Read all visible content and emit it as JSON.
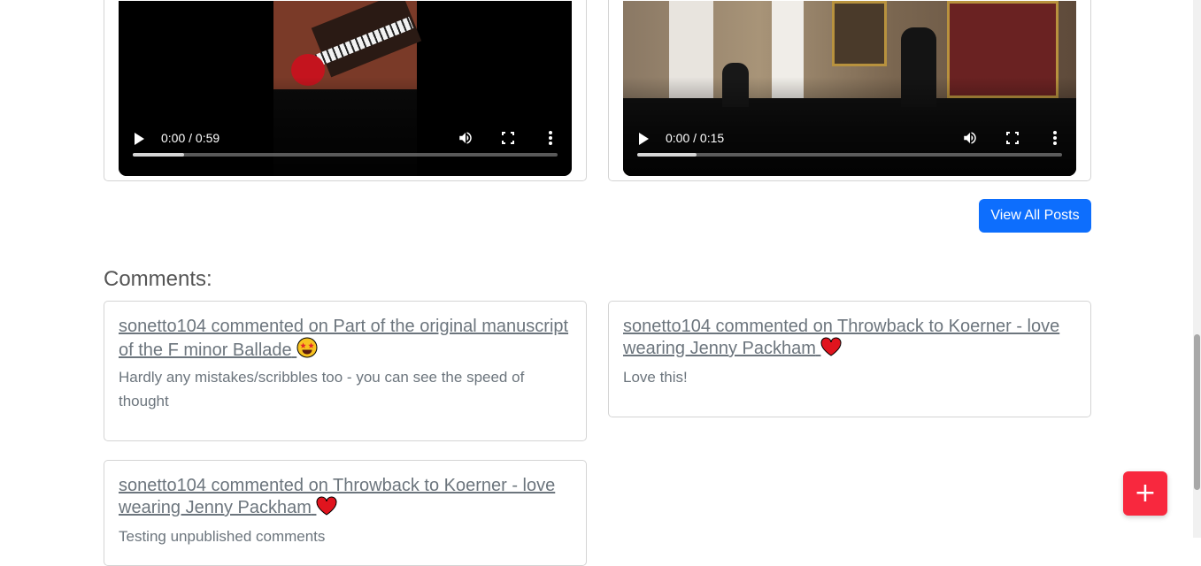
{
  "videos": [
    {
      "time": "0:00 / 0:59",
      "buffered_fraction": 0.12
    },
    {
      "time": "0:00 / 0:15",
      "buffered_fraction": 0.14
    }
  ],
  "view_all_label": "View All Posts",
  "comments_heading": "Comments:",
  "comments": [
    {
      "title": "sonetto104 commented on Part of the original manuscript of the F minor Ballade",
      "emoji": "star-struck",
      "body": "Hardly any mistakes/scribbles too - you can see the speed of thought"
    },
    {
      "title": "sonetto104 commented on Throwback to Koerner - love wearing Jenny Packham",
      "emoji": "heart",
      "body": "Love this!"
    },
    {
      "title": "sonetto104 commented on Throwback to Koerner - love wearing Jenny Packham",
      "emoji": "heart",
      "body": "Testing unpublished comments"
    }
  ],
  "fab_label": "+",
  "colors": {
    "primary": "#0d6efd",
    "fab": "#f8283e",
    "muted": "#6c757d"
  }
}
